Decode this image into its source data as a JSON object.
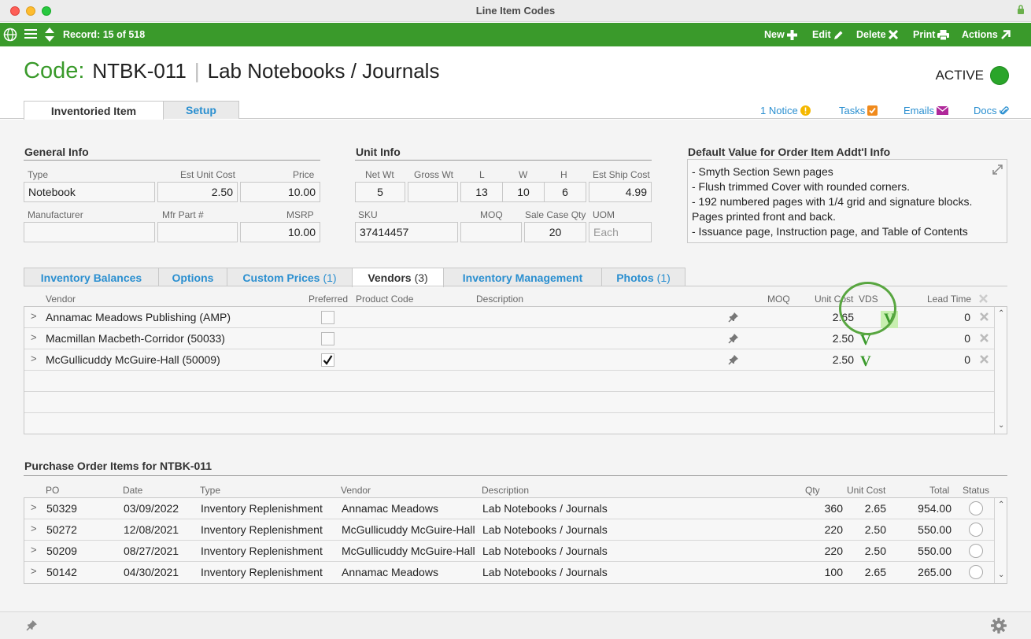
{
  "window": {
    "title": "Line Item Codes"
  },
  "toolbar": {
    "record": "Record: 15 of 518",
    "new": "New",
    "edit": "Edit",
    "delete": "Delete",
    "print": "Print",
    "actions": "Actions"
  },
  "header": {
    "code_label": "Code:",
    "code": "NTBK-011",
    "name": "Lab Notebooks / Journals",
    "status": "ACTIVE"
  },
  "main_tabs": [
    "Inventoried Item",
    "Setup"
  ],
  "right_links": {
    "notice": "1 Notice",
    "tasks": "Tasks",
    "emails": "Emails",
    "docs": "Docs"
  },
  "general_info": {
    "title": "General Info",
    "type_label": "Type",
    "type": "Notebook",
    "est_unit_cost_label": "Est Unit Cost",
    "est_unit_cost": "2.50",
    "price_label": "Price",
    "price": "10.00",
    "manufacturer_label": "Manufacturer",
    "manufacturer": "",
    "mfr_part_label": "Mfr Part #",
    "mfr_part": "",
    "msrp_label": "MSRP",
    "msrp": "10.00"
  },
  "unit_info": {
    "title": "Unit Info",
    "net_wt_label": "Net Wt",
    "net_wt": "5",
    "gross_wt_label": "Gross Wt",
    "gross_wt": "",
    "l_label": "L",
    "l": "13",
    "w_label": "W",
    "w": "10",
    "h_label": "H",
    "h": "6",
    "est_ship_cost_label": "Est Ship Cost",
    "est_ship_cost": "4.99",
    "sku_label": "SKU",
    "sku": "37414457",
    "moq_label": "MOQ",
    "moq": "",
    "sale_case_qty_label": "Sale Case Qty",
    "sale_case_qty": "20",
    "uom_label": "UOM",
    "uom_placeholder": "Each"
  },
  "default_value": {
    "title": "Default Value for Order Item Addt'l Info",
    "lines": [
      "- Smyth Section Sewn pages",
      "- Flush trimmed Cover with rounded corners.",
      "- 192 numbered pages with 1/4 grid and signature blocks.",
      "Pages printed front and back.",
      "- Issuance page, Instruction page, and Table of Contents"
    ]
  },
  "sub_tabs": [
    {
      "label": "Inventory Balances",
      "count": ""
    },
    {
      "label": "Options",
      "count": ""
    },
    {
      "label": "Custom Prices",
      "count": "(1)"
    },
    {
      "label": "Vendors",
      "count": "(3)"
    },
    {
      "label": "Inventory Management",
      "count": ""
    },
    {
      "label": "Photos",
      "count": "(1)"
    }
  ],
  "vendors": {
    "headers": {
      "vendor": "Vendor",
      "preferred": "Preferred",
      "product_code": "Product Code",
      "description": "Description",
      "moq": "MOQ",
      "unit_cost": "Unit Cost",
      "vds": "VDS",
      "lead_time": "Lead Time"
    },
    "rows": [
      {
        "chev": ">",
        "name": "Annamac Meadows Publishing  (AMP)",
        "preferred": false,
        "unit_cost": "2.65",
        "vds": "V",
        "lead_time": "0"
      },
      {
        "chev": ">",
        "name": "Macmillan Macbeth-Corridor  (50033)",
        "preferred": false,
        "unit_cost": "2.50",
        "vds": "V",
        "lead_time": "0"
      },
      {
        "chev": ">",
        "name": "McGullicuddy McGuire-Hall  (50009)",
        "preferred": true,
        "unit_cost": "2.50",
        "vds": "V",
        "lead_time": "0"
      }
    ]
  },
  "po_items": {
    "title": "Purchase Order Items for NTBK-011",
    "headers": {
      "po": "PO",
      "date": "Date",
      "type": "Type",
      "vendor": "Vendor",
      "description": "Description",
      "qty": "Qty",
      "unit_cost": "Unit Cost",
      "total": "Total",
      "status": "Status"
    },
    "rows": [
      {
        "chev": ">",
        "po": "50329",
        "date": "03/09/2022",
        "type": "Inventory Replenishment",
        "vendor": "Annamac Meadows",
        "description": "Lab Notebooks / Journals",
        "qty": "360",
        "unit_cost": "2.65",
        "total": "954.00"
      },
      {
        "chev": ">",
        "po": "50272",
        "date": "12/08/2021",
        "type": "Inventory Replenishment",
        "vendor": "McGullicuddy McGuire-Hall",
        "description": "Lab Notebooks / Journals",
        "qty": "220",
        "unit_cost": "2.50",
        "total": "550.00"
      },
      {
        "chev": ">",
        "po": "50209",
        "date": "08/27/2021",
        "type": "Inventory Replenishment",
        "vendor": "McGullicuddy McGuire-Hall",
        "description": "Lab Notebooks / Journals",
        "qty": "220",
        "unit_cost": "2.50",
        "total": "550.00"
      },
      {
        "chev": ">",
        "po": "50142",
        "date": "04/30/2021",
        "type": "Inventory Replenishment",
        "vendor": "Annamac Meadows",
        "description": "Lab Notebooks / Journals",
        "qty": "100",
        "unit_cost": "2.65",
        "total": "265.00"
      }
    ]
  },
  "colors": {
    "brand_green": "#3a9a2b",
    "link_blue": "#2a8fd0",
    "active_green": "#2aa52a"
  }
}
